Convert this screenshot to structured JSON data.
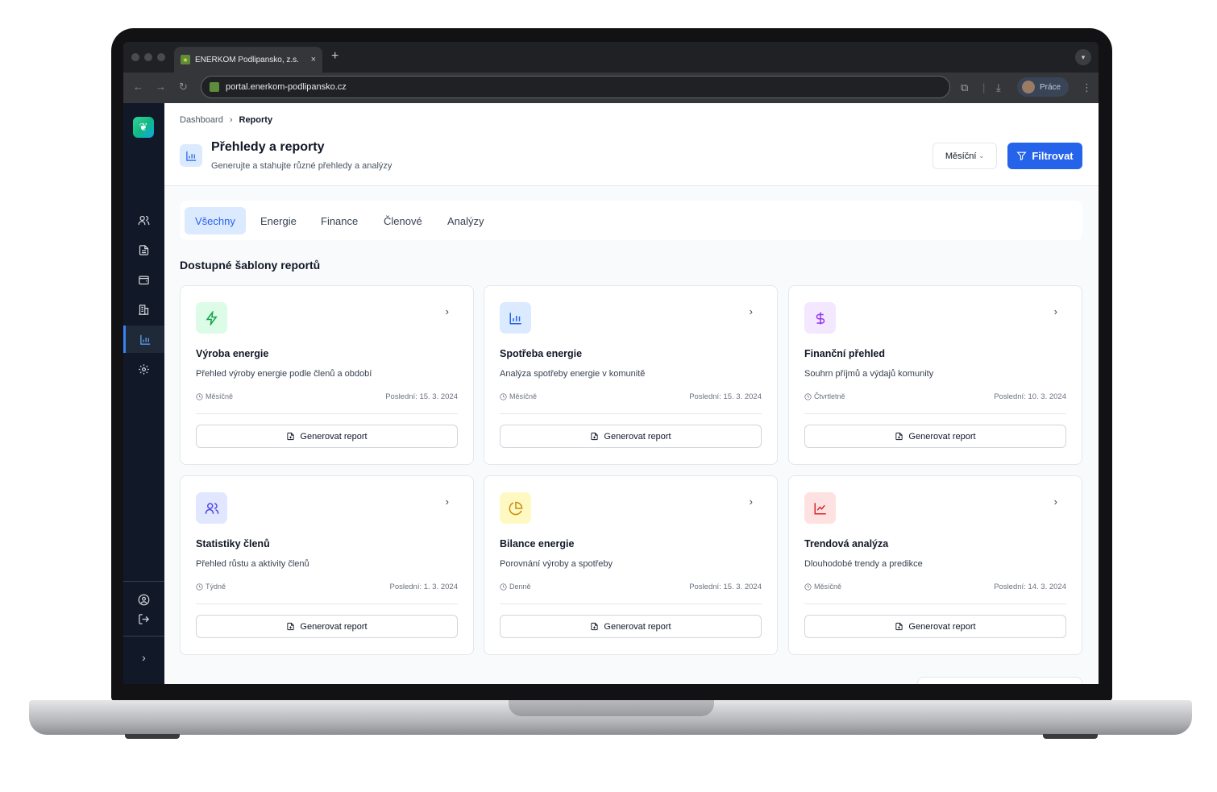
{
  "browser": {
    "tab_title": "ENERKOM Podlipansko, z.s.",
    "tab_close": "×",
    "new_tab": "+",
    "url": "portal.enerkom-podlipansko.cz",
    "profile_label": "Práce"
  },
  "breadcrumb": {
    "home": "Dashboard",
    "separator": "›",
    "current": "Reporty"
  },
  "page": {
    "title": "Přehledy a reporty",
    "subtitle": "Generujte a stahujte různé přehledy a analýzy",
    "period_select": "Měsíční",
    "filter_button": "Filtrovat"
  },
  "tabs": [
    "Všechny",
    "Energie",
    "Finance",
    "Členové",
    "Analýzy"
  ],
  "active_tab": "Všechny",
  "section_title": "Dostupné šablony reportů",
  "cards": [
    {
      "icon": "lightning-icon",
      "color": "#16a34a",
      "bg": "#dcfce7",
      "title": "Výroba energie",
      "description": "Přehled výroby energie podle členů a období",
      "frequency": "Měsíčně",
      "last": "Poslední: 15. 3. 2024",
      "button": "Generovat report"
    },
    {
      "icon": "bar-chart-icon",
      "color": "#2563eb",
      "bg": "#dbeafe",
      "title": "Spotřeba energie",
      "description": "Analýza spotřeby energie v komunitě",
      "frequency": "Měsíčně",
      "last": "Poslední: 15. 3. 2024",
      "button": "Generovat report"
    },
    {
      "icon": "dollar-icon",
      "color": "#9333ea",
      "bg": "#f3e8ff",
      "title": "Finanční přehled",
      "description": "Souhrn příjmů a výdajů komunity",
      "frequency": "Čtvrtletně",
      "last": "Poslední: 10. 3. 2024",
      "button": "Generovat report"
    },
    {
      "icon": "users-icon",
      "color": "#4f46e5",
      "bg": "#e0e7ff",
      "title": "Statistiky členů",
      "description": "Přehled růstu a aktivity členů",
      "frequency": "Týdně",
      "last": "Poslední: 1. 3. 2024",
      "button": "Generovat report"
    },
    {
      "icon": "pie-chart-icon",
      "color": "#ca8a04",
      "bg": "#fef9c3",
      "title": "Bilance energie",
      "description": "Porovnání výroby a spotřeby",
      "frequency": "Denně",
      "last": "Poslední: 15. 3. 2024",
      "button": "Generovat report"
    },
    {
      "icon": "trend-chart-icon",
      "color": "#dc2626",
      "bg": "#fee2e2",
      "title": "Trendová analýza",
      "description": "Dlouhodobé trendy a predikce",
      "frequency": "Měsíčně",
      "last": "Poslední: 14. 3. 2024",
      "button": "Generovat report"
    }
  ],
  "sidebar": {
    "items": [
      "users-icon",
      "document-icon",
      "wallet-icon",
      "building-icon",
      "reports-icon",
      "settings-icon"
    ],
    "bottom": [
      "account-icon",
      "logout-icon"
    ],
    "expand": "›"
  }
}
